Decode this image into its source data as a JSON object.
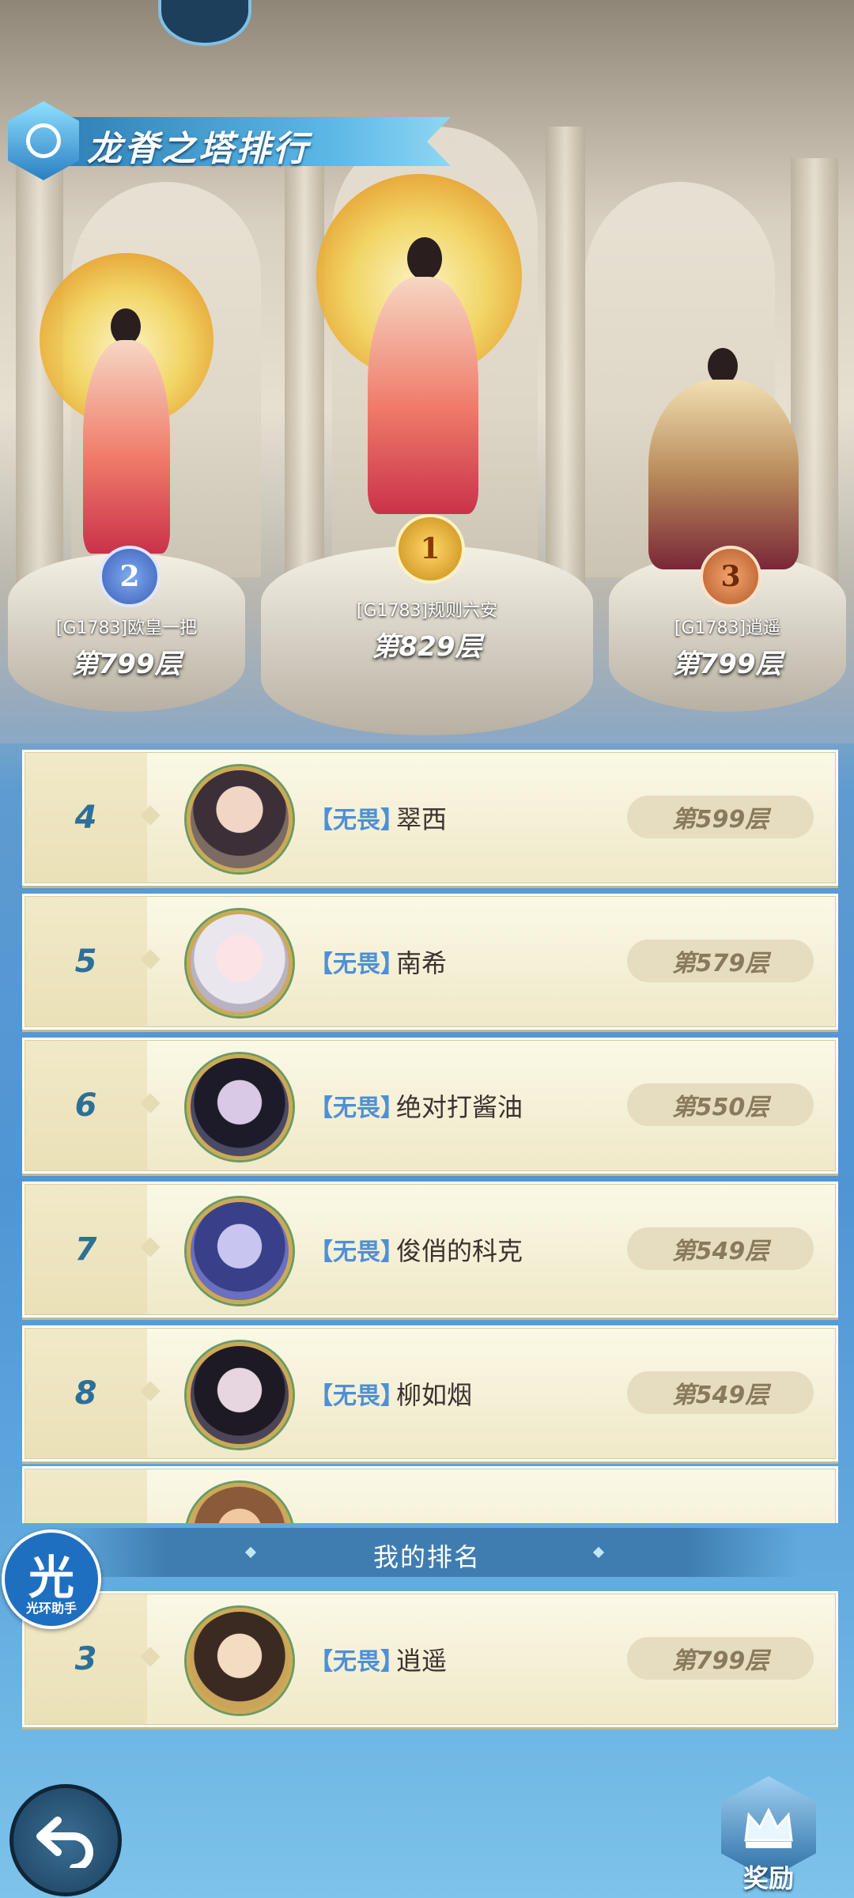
{
  "header": {
    "title": "龙脊之塔排行"
  },
  "podium": [
    {
      "rank": "2",
      "name": "[G1783]欧皇一把",
      "floor": "第799层"
    },
    {
      "rank": "1",
      "name": "[G1783]规则六安",
      "floor": "第829层"
    },
    {
      "rank": "3",
      "name": "[G1783]逍遥",
      "floor": "第799层"
    }
  ],
  "rows": [
    {
      "rank": "4",
      "tag": "【无畏】",
      "name": "翠西",
      "floor": "第599层"
    },
    {
      "rank": "5",
      "tag": "【无畏】",
      "name": "南希",
      "floor": "第579层"
    },
    {
      "rank": "6",
      "tag": "【无畏】",
      "name": "绝对打酱油",
      "floor": "第550层"
    },
    {
      "rank": "7",
      "tag": "【无畏】",
      "name": "俊俏的科克",
      "floor": "第549层"
    },
    {
      "rank": "8",
      "tag": "【无畏】",
      "name": "柳如烟",
      "floor": "第549层"
    }
  ],
  "my_rank": {
    "label": "我的排名",
    "rank": "3",
    "tag": "【无畏】",
    "name": "逍遥",
    "floor": "第799层"
  },
  "helper": {
    "icon_char": "光",
    "label": "光环助手"
  },
  "footer": {
    "reward_label": "奖励"
  },
  "icons": {
    "back": "back-arrow-icon",
    "reward": "crown-icon"
  },
  "colors": {
    "accent": "#4f8fd6",
    "rank_number": "#2e6f98",
    "row_bg": "#fbf8e6"
  }
}
